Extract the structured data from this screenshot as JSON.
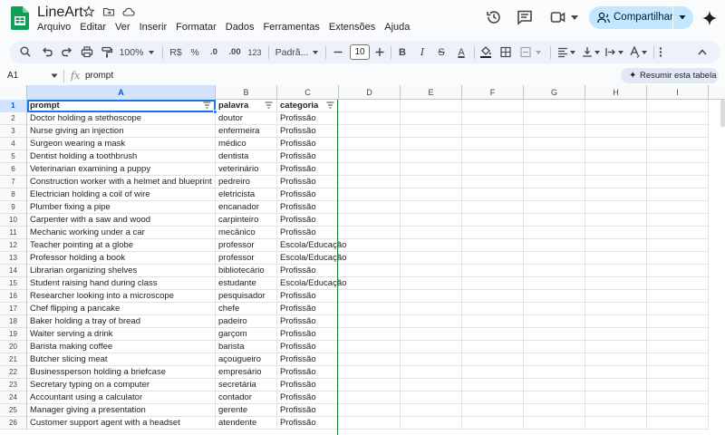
{
  "app": {
    "title": "LineArt",
    "menu": [
      "Arquivo",
      "Editar",
      "Ver",
      "Inserir",
      "Formatar",
      "Dados",
      "Ferramentas",
      "Extensões",
      "Ajuda"
    ],
    "share_label": "Compartilhar"
  },
  "toolbar": {
    "zoom": "100%",
    "currency": "R$",
    "percent": "%",
    "decrease_decimals": ".0",
    "increase_decimals": ".00",
    "number_format": "123",
    "font_name": "Padrã...",
    "font_size": "10",
    "bold": "B",
    "italic": "I",
    "strike": "S",
    "text_color": "A"
  },
  "formula_bar": {
    "cell_ref": "A1",
    "fx": "fx",
    "content": "prompt",
    "summary_button": "Resumir esta tabela"
  },
  "grid": {
    "columns": [
      "A",
      "B",
      "C",
      "D",
      "E",
      "F",
      "G",
      "H",
      "I"
    ],
    "selected_column": "A",
    "selected_row": "1",
    "header_row": [
      "prompt",
      "palavra",
      "categoria"
    ],
    "rows": [
      {
        "n": "2",
        "prompt": "Doctor holding a stethoscope",
        "palavra": "doutor",
        "categoria": "Profissão"
      },
      {
        "n": "3",
        "prompt": "Nurse giving an injection",
        "palavra": "enfermeira",
        "categoria": "Profissão"
      },
      {
        "n": "4",
        "prompt": "Surgeon wearing a mask",
        "palavra": "médico",
        "categoria": "Profissão"
      },
      {
        "n": "5",
        "prompt": "Dentist holding a toothbrush",
        "palavra": "dentista",
        "categoria": "Profissão"
      },
      {
        "n": "6",
        "prompt": "Veterinarian examining a puppy",
        "palavra": "veterinário",
        "categoria": "Profissão"
      },
      {
        "n": "7",
        "prompt": "Construction worker with a helmet and blueprint",
        "palavra": "pedreiro",
        "categoria": "Profissão"
      },
      {
        "n": "8",
        "prompt": "Electrician holding a coil of wire",
        "palavra": "eletricista",
        "categoria": "Profissão"
      },
      {
        "n": "9",
        "prompt": "Plumber fixing a pipe",
        "palavra": "encanador",
        "categoria": "Profissão"
      },
      {
        "n": "10",
        "prompt": "Carpenter with a saw and wood",
        "palavra": "carpinteiro",
        "categoria": "Profissão"
      },
      {
        "n": "11",
        "prompt": "Mechanic working under a car",
        "palavra": "mecânico",
        "categoria": "Profissão"
      },
      {
        "n": "12",
        "prompt": "Teacher pointing at a globe",
        "palavra": "professor",
        "categoria": "Escola/Educação"
      },
      {
        "n": "13",
        "prompt": "Professor holding a book",
        "palavra": "professor",
        "categoria": "Escola/Educação"
      },
      {
        "n": "14",
        "prompt": "Librarian organizing shelves",
        "palavra": "bibliotecário",
        "categoria": "Profissão"
      },
      {
        "n": "15",
        "prompt": "Student raising hand during class",
        "palavra": "estudante",
        "categoria": "Escola/Educação"
      },
      {
        "n": "16",
        "prompt": "Researcher looking into a microscope",
        "palavra": "pesquisador",
        "categoria": "Profissão"
      },
      {
        "n": "17",
        "prompt": "Chef flipping a pancake",
        "palavra": "chefe",
        "categoria": "Profissão"
      },
      {
        "n": "18",
        "prompt": "Baker holding a tray of bread",
        "palavra": "padeiro",
        "categoria": "Profissão"
      },
      {
        "n": "19",
        "prompt": "Waiter serving a drink",
        "palavra": "garçom",
        "categoria": "Profissão"
      },
      {
        "n": "20",
        "prompt": "Barista making coffee",
        "palavra": "barista",
        "categoria": "Profissão"
      },
      {
        "n": "21",
        "prompt": "Butcher slicing meat",
        "palavra": "açougueiro",
        "categoria": "Profissão"
      },
      {
        "n": "22",
        "prompt": "Businessperson holding a briefcase",
        "palavra": "empresário",
        "categoria": "Profissão"
      },
      {
        "n": "23",
        "prompt": "Secretary typing on a computer",
        "palavra": "secretária",
        "categoria": "Profissão"
      },
      {
        "n": "24",
        "prompt": "Accountant using a calculator",
        "palavra": "contador",
        "categoria": "Profissão"
      },
      {
        "n": "25",
        "prompt": "Manager giving a presentation",
        "palavra": "gerente",
        "categoria": "Profissão"
      },
      {
        "n": "26",
        "prompt": "Customer support agent with a headset",
        "palavra": "atendente",
        "categoria": "Profissão"
      }
    ]
  },
  "colors": {
    "accent": "#1a73e8",
    "share_bg": "#c2e7ff",
    "range_border": "#188038",
    "sheets_green": "#0f9d58"
  },
  "icons": [
    "sheets-logo-icon",
    "star-icon",
    "move-folder-icon",
    "cloud-status-icon",
    "history-icon",
    "comment-icon",
    "meet-icon",
    "gemini-icon",
    "search-icon",
    "undo-icon",
    "redo-icon",
    "print-icon",
    "paint-format-icon",
    "filter-icon"
  ]
}
